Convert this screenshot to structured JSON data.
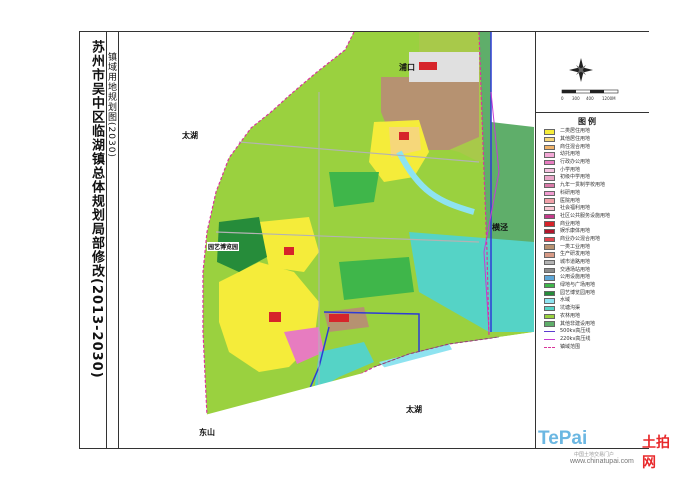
{
  "title": "苏州市吴中区临湖镇总体规划局部修改(2013-2030)",
  "subtitle": "镇域用地规划图(2030)",
  "places": {
    "lake_nw": "太湖",
    "lake_s": "太湖",
    "town_n": "浦口",
    "town_e": "横泾",
    "town_sw": "东山",
    "park": "园艺博览园"
  },
  "scale": {
    "labels": [
      "0",
      "300",
      "400",
      "1200M"
    ]
  },
  "legend": {
    "title": "图例",
    "items": [
      {
        "label": "二类居住用地",
        "color": "#f5ec3a",
        "kind": "fill"
      },
      {
        "label": "其他居住用地",
        "color": "#f6d77a",
        "kind": "fill"
      },
      {
        "label": "商住混合用地",
        "color": "#f0b36a",
        "kind": "fill"
      },
      {
        "label": "幼托用地",
        "color": "#f3a8d6",
        "kind": "fill"
      },
      {
        "label": "行政办公用地",
        "color": "#e77cc0",
        "kind": "fill"
      },
      {
        "label": "小学用地",
        "color": "#f4c2e0",
        "kind": "fill"
      },
      {
        "label": "初级中学用地",
        "color": "#e9a6c9",
        "kind": "fill"
      },
      {
        "label": "九年一贯制学校用地",
        "color": "#d97aa8",
        "kind": "fill"
      },
      {
        "label": "科研用地",
        "color": "#f19bd0",
        "kind": "fill"
      },
      {
        "label": "医院用地",
        "color": "#f0a0a8",
        "kind": "fill"
      },
      {
        "label": "社会福利用地",
        "color": "#f8c9d3",
        "kind": "fill"
      },
      {
        "label": "社区公共服务设施用地",
        "color": "#c43a8b",
        "kind": "fill"
      },
      {
        "label": "商业用地",
        "color": "#d6242a",
        "kind": "fill"
      },
      {
        "label": "娱乐康体用地",
        "color": "#b0162b",
        "kind": "fill"
      },
      {
        "label": "商业办公混合用地",
        "color": "#e2474f",
        "kind": "fill"
      },
      {
        "label": "一类工业用地",
        "color": "#b69271",
        "kind": "fill"
      },
      {
        "label": "生产研发用地",
        "color": "#d79a86",
        "kind": "fill"
      },
      {
        "label": "城市道路用地",
        "color": "#b3b3b3",
        "kind": "fill"
      },
      {
        "label": "交通场站用地",
        "color": "#8c8c8c",
        "kind": "fill"
      },
      {
        "label": "公用设施用地",
        "color": "#5da7d8",
        "kind": "fill"
      },
      {
        "label": "绿地与广场用地",
        "color": "#3fb64a",
        "kind": "fill"
      },
      {
        "label": "园艺博览园用地",
        "color": "#268c3a",
        "kind": "fill"
      },
      {
        "label": "水域",
        "color": "#8ee3f0",
        "kind": "fill"
      },
      {
        "label": "坑塘沟渠",
        "color": "#55d3c6",
        "kind": "fill"
      },
      {
        "label": "农林用地",
        "color": "#9ad13f",
        "kind": "fill"
      },
      {
        "label": "其他非建设用地",
        "color": "#5fae6a",
        "kind": "fill"
      },
      {
        "label": "500kv高压线",
        "color": "#5a3ccf",
        "kind": "line"
      },
      {
        "label": "220kv高压线",
        "color": "#c63bd4",
        "kind": "line"
      },
      {
        "label": "镇域范围",
        "color": "#d9359a",
        "kind": "line"
      }
    ]
  },
  "watermark": {
    "logo_a": "TePai",
    "logo_b": "土拍网",
    "sub": "中国土地交易门户",
    "url": "www.chinatupai.com"
  },
  "colors": {
    "water": "#8ee3f0",
    "farmland": "#9ad13f",
    "residential": "#f5ec3a",
    "industrial": "#b69271",
    "boundary": "#d9359a",
    "road_blue": "#2e3cd6"
  }
}
